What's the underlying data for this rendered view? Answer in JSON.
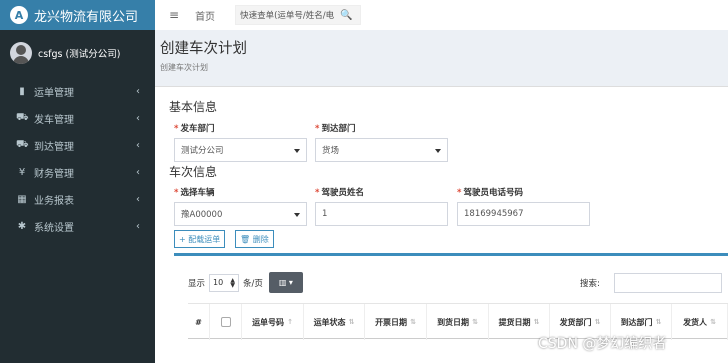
{
  "brand": {
    "logo_letter": "A",
    "name": "龙兴物流有限公司"
  },
  "user": {
    "name": "csfgs (测试分公司)"
  },
  "sidebar": {
    "items": [
      {
        "icon": "clipboard-icon",
        "glyph": "▮",
        "label": "运单管理",
        "chevron": "‹"
      },
      {
        "icon": "truck-icon",
        "glyph": "⛟",
        "label": "发车管理",
        "chevron": "‹"
      },
      {
        "icon": "truck-arrive-icon",
        "glyph": "⛟",
        "label": "到达管理",
        "chevron": "‹"
      },
      {
        "icon": "yen-icon",
        "glyph": "¥",
        "label": "财务管理",
        "chevron": "‹"
      },
      {
        "icon": "table-icon",
        "glyph": "▦",
        "label": "业务报表",
        "chevron": "‹"
      },
      {
        "icon": "gear-icon",
        "glyph": "✱",
        "label": "系统设置",
        "chevron": "‹"
      }
    ]
  },
  "header": {
    "menu_glyph": "≡",
    "home_label": "首页",
    "search_value": "快速查单(运单号/姓名/电",
    "search_glyph": "🔍"
  },
  "content": {
    "title": "创建车次计划",
    "subtitle": "创建车次计划"
  },
  "form": {
    "basic_title": "基本信息",
    "depart_label": "发车部门",
    "depart_value": "测试分公司",
    "arrive_label": "到达部门",
    "arrive_value": "货场",
    "trip_title": "车次信息",
    "vehicle_label": "选择车辆",
    "vehicle_value": "豫A00000",
    "driver_label": "驾驶员姓名",
    "driver_value": "1",
    "phone_label": "驾驶员电话号码",
    "phone_value": "18169945967",
    "required_mark": "*"
  },
  "actions": {
    "add_label": "+ 配载运单",
    "delete_label": "🗑 删除"
  },
  "table": {
    "show_label": "显示",
    "page_len": "10",
    "per_page_label": "条/页",
    "col_btn": "▥ ▾",
    "search_label": "搜索:",
    "columns": [
      "#",
      "",
      "运单号码",
      "运单状态",
      "开票日期",
      "到货日期",
      "提货日期",
      "发货部门",
      "到达部门",
      "发货人"
    ],
    "sort_glyph": "⇅",
    "sort_active_glyph": "↑"
  },
  "watermark": "CSDN @梦幻编织者",
  "colors": {
    "sidebar": "#222d32",
    "brand": "#367fa9",
    "accent": "#3c8dbc"
  }
}
